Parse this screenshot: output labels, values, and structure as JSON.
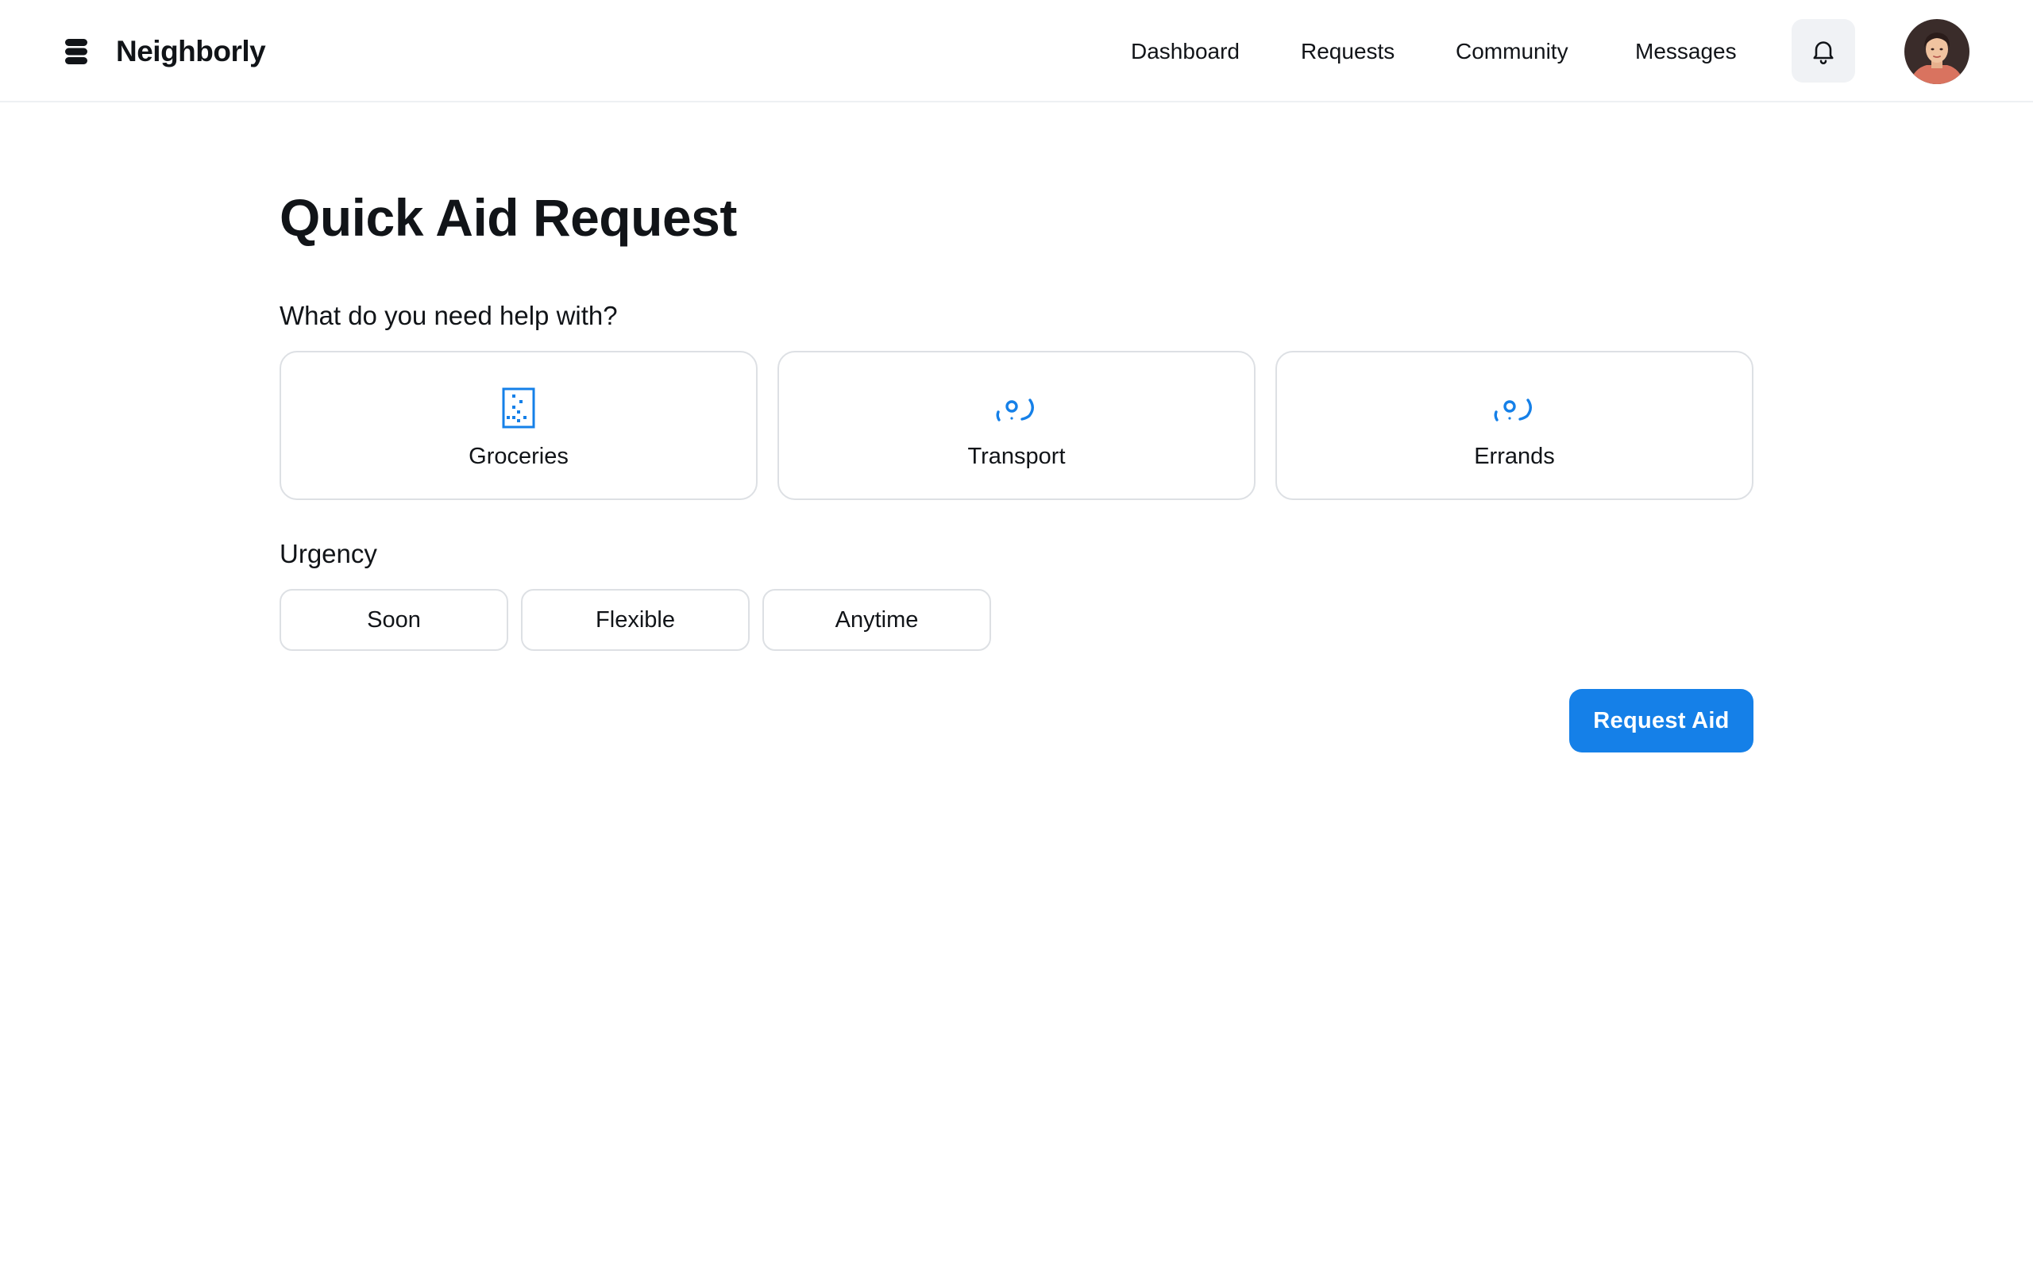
{
  "app": {
    "name": "Neighborly",
    "logo_icon": "stacked-layers-icon"
  },
  "nav": {
    "items": [
      {
        "label": "Dashboard"
      },
      {
        "label": "Requests"
      },
      {
        "label": "Community"
      },
      {
        "label": "Messages"
      }
    ],
    "notifications_icon": "bell-icon",
    "avatar_icon": "user-avatar"
  },
  "form": {
    "title": "Quick Aid Request",
    "help_label": "What do you need help with?",
    "categories": [
      {
        "label": "Groceries",
        "icon": "abacus-icon"
      },
      {
        "label": "Transport",
        "icon": "wheelchair-icon"
      },
      {
        "label": "Errands",
        "icon": "wheelchair-icon"
      }
    ],
    "urgency_label": "Urgency",
    "urgency_options": [
      {
        "label": "Soon"
      },
      {
        "label": "Flexible"
      },
      {
        "label": "Anytime"
      }
    ],
    "submit_label": "Request Aid"
  },
  "colors": {
    "accent": "#1580e8",
    "text": "#111418",
    "border": "#dde0e4"
  }
}
